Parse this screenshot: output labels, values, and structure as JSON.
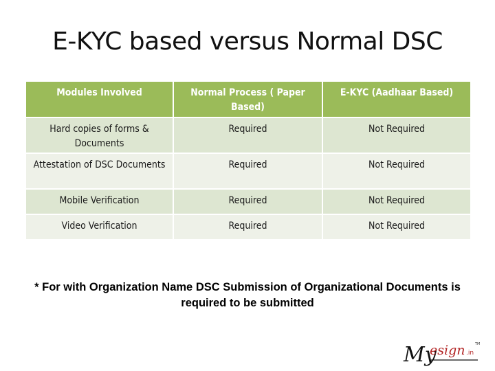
{
  "title": "E-KYC based versus Normal DSC",
  "table": {
    "headers": [
      "Modules Involved",
      "Normal Process ( Paper Based)",
      "E-KYC (Aadhaar Based)"
    ],
    "rows": [
      [
        "Hard copies of forms & Documents",
        "Required",
        "Not Required"
      ],
      [
        "Attestation of DSC Documents",
        "Required",
        "Not Required"
      ],
      [
        "Mobile Verification",
        "Required",
        "Not Required"
      ],
      [
        "Video Verification",
        "Required",
        "Not Required"
      ]
    ]
  },
  "footnote": {
    "line1": "*  For with Organization Name DSC Submission of Organizational Documents is",
    "line2": "required to be submitted"
  },
  "logo": {
    "my": "My",
    "esign": "esign",
    "suffix": ".in",
    "tm": "TM",
    "colors": {
      "my": "#111111",
      "esign": "#b22222"
    }
  },
  "colors": {
    "header_bg": "#9bbb59",
    "row_odd_bg": "#dde6d1",
    "row_even_bg": "#eef1e8"
  }
}
